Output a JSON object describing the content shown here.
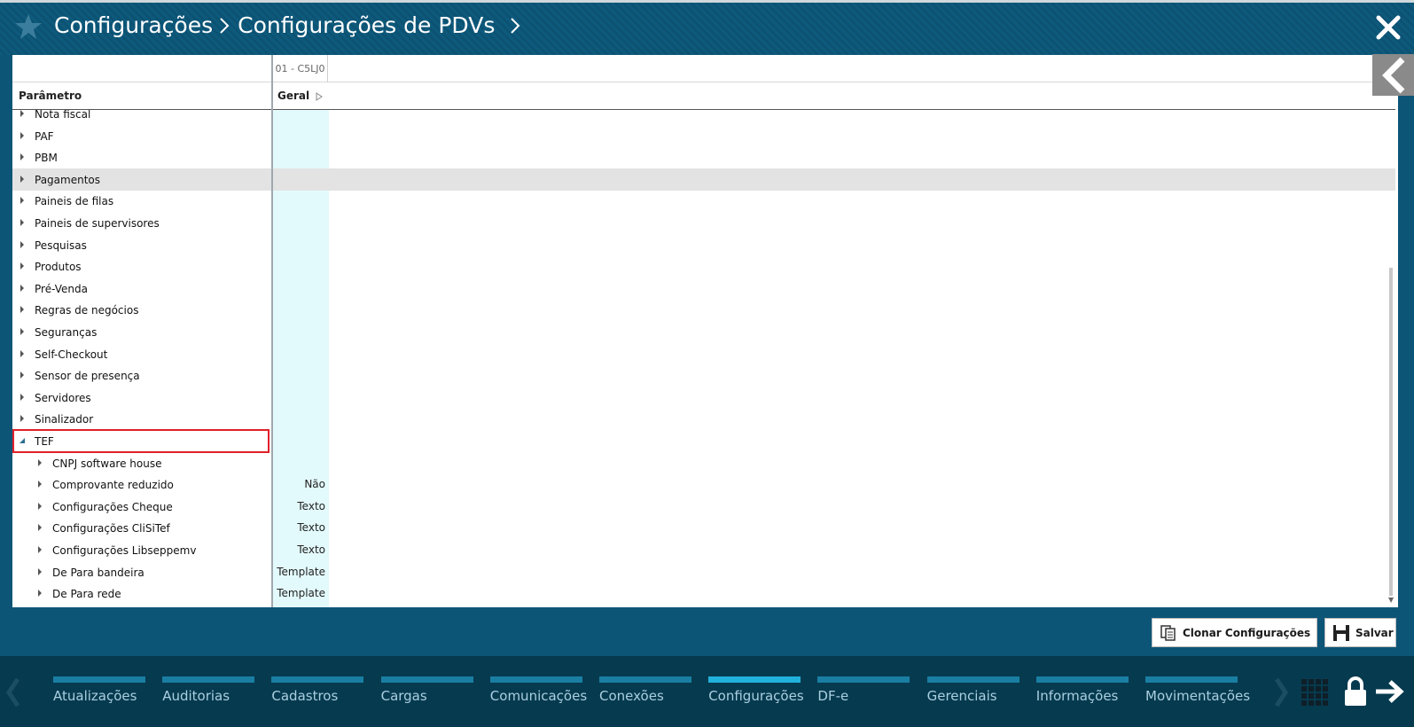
{
  "header": {
    "breadcrumb": [
      "Configurações",
      "Configurações de PDVs"
    ]
  },
  "grid": {
    "store_column": "01 - C5LJ0",
    "param_header": "Parâmetro",
    "group_header": "Geral"
  },
  "rows": [
    {
      "label": "Nota fiscal",
      "level": 0,
      "value": ""
    },
    {
      "label": "PAF",
      "level": 0,
      "value": ""
    },
    {
      "label": "PBM",
      "level": 0,
      "value": ""
    },
    {
      "label": "Pagamentos",
      "level": 0,
      "value": "",
      "selected": true
    },
    {
      "label": "Paineis de filas",
      "level": 0,
      "value": ""
    },
    {
      "label": "Paineis de supervisores",
      "level": 0,
      "value": ""
    },
    {
      "label": "Pesquisas",
      "level": 0,
      "value": ""
    },
    {
      "label": "Produtos",
      "level": 0,
      "value": ""
    },
    {
      "label": "Pré-Venda",
      "level": 0,
      "value": ""
    },
    {
      "label": "Regras de negócios",
      "level": 0,
      "value": ""
    },
    {
      "label": "Seguranças",
      "level": 0,
      "value": ""
    },
    {
      "label": "Self-Checkout",
      "level": 0,
      "value": ""
    },
    {
      "label": "Sensor de presença",
      "level": 0,
      "value": ""
    },
    {
      "label": "Servidores",
      "level": 0,
      "value": ""
    },
    {
      "label": "Sinalizador",
      "level": 0,
      "value": ""
    },
    {
      "label": "TEF",
      "level": 0,
      "value": "",
      "expanded": true,
      "highlighted": true
    },
    {
      "label": "CNPJ software house",
      "level": 1,
      "value": ""
    },
    {
      "label": "Comprovante reduzido",
      "level": 1,
      "value": "Não"
    },
    {
      "label": "Configurações Cheque",
      "level": 1,
      "value": "Texto"
    },
    {
      "label": "Configurações CliSiTef",
      "level": 1,
      "value": "Texto"
    },
    {
      "label": "Configurações Libseppemv",
      "level": 1,
      "value": "Texto"
    },
    {
      "label": "De Para bandeira",
      "level": 1,
      "value": "Template"
    },
    {
      "label": "De Para rede",
      "level": 1,
      "value": "Template"
    }
  ],
  "actions": {
    "clone_label": "Clonar Configurações",
    "save_label": "Salvar"
  },
  "nav": {
    "tabs": [
      "Atualizações",
      "Auditorias",
      "Cadastros",
      "Cargas",
      "Comunicações",
      "Conexões",
      "Configurações",
      "DF-e",
      "Gerenciais",
      "Informações",
      "Movimentações"
    ],
    "active": "Configurações"
  }
}
